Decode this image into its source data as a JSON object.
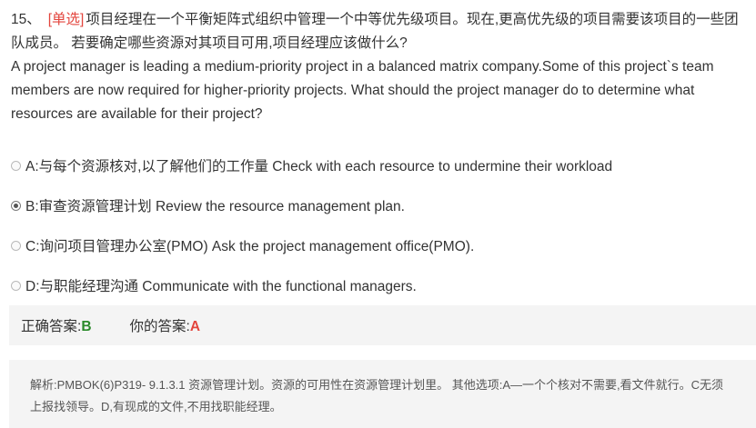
{
  "question": {
    "number": "15、",
    "type_tag": "[单选]",
    "text_cn": "项目经理在一个平衡矩阵式组织中管理一个中等优先级项目。现在,更高优先级的项目需要该项目的一些团队成员。 若要确定哪些资源对其项目可用,项目经理应该做什么?",
    "text_en": "A project manager is leading a medium-priority project in a balanced matrix company.Some of this project`s team members are now required for higher-priority projects. What should the project manager do to determine what resources are available for their project?"
  },
  "options": [
    {
      "letter": "A",
      "text": "A:与每个资源核对,以了解他们的工作量 Check with each resource to undermine their workload",
      "selected": false
    },
    {
      "letter": "B",
      "text": "B:审查资源管理计划 Review the resource management plan.",
      "selected": true
    },
    {
      "letter": "C",
      "text": "C:询问项目管理办公室(PMO) Ask the project management office(PMO).",
      "selected": false
    },
    {
      "letter": "D",
      "text": "D:与职能经理沟通 Communicate with the functional managers.",
      "selected": false
    }
  ],
  "result": {
    "correct_label": "正确答案:",
    "correct_value": "B",
    "yours_label": "你的答案:",
    "yours_value": "A"
  },
  "analysis": {
    "text": "解析:PMBOK(6)P319- 9.1.3.1 资源管理计划。资源的可用性在资源管理计划里。 其他选项:A—一个个核对不需要,看文件就行。C无须上报找领导。D,有现成的文件,不用找职能经理。"
  },
  "colors": {
    "type_tag": "#e3453d",
    "correct": "#2a8a2a",
    "wrong": "#e3453d",
    "panel_bg": "#f4f4f4"
  }
}
